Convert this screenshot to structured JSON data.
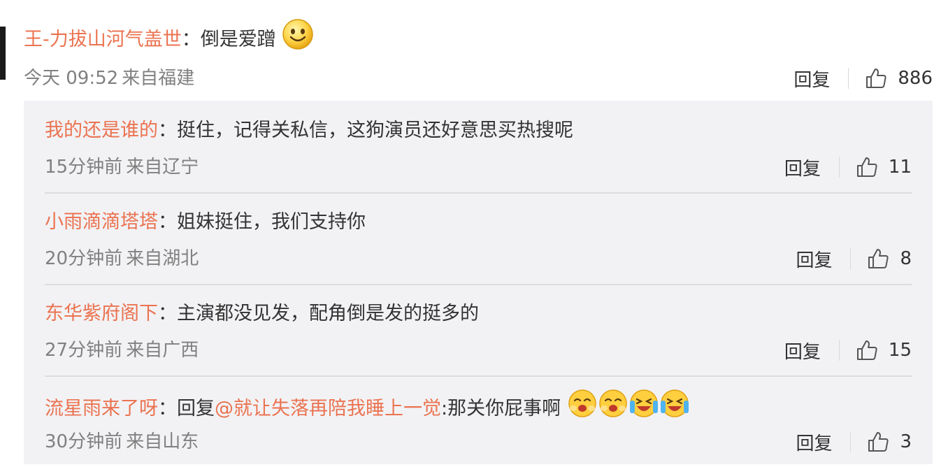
{
  "top_comment": {
    "username": "王-力拔山河气盖世",
    "separator": "：",
    "text": "倒是爱蹭",
    "time": "今天 09:52",
    "source": "来自福建",
    "reply_label": "回复",
    "likes": "886"
  },
  "replies": [
    {
      "username": "我的还是谁的",
      "separator": "：",
      "text": "挺住，记得关私信，这狗演员还好意思买热搜呢",
      "time": "15分钟前",
      "source": "来自辽宁",
      "reply_label": "回复",
      "likes": "11"
    },
    {
      "username": "小雨滴滴塔塔",
      "separator": "：",
      "text": "姐妹挺住，我们支持你",
      "time": "20分钟前",
      "source": "来自湖北",
      "reply_label": "回复",
      "likes": "8"
    },
    {
      "username": "东华紫府阁下",
      "separator": "：",
      "text": "主演都没见发，配角倒是发的挺多的",
      "time": "27分钟前",
      "source": "来自广西",
      "reply_label": "回复",
      "likes": "15"
    },
    {
      "username": "流星雨来了呀",
      "separator": "：",
      "reply_prefix": "回复",
      "mention": "@就让失落再陪我睡上一觉",
      "text": ":那关你屁事啊",
      "time": "30分钟前",
      "source": "来自山东",
      "reply_label": "回复",
      "likes": "3"
    }
  ],
  "icons": {
    "smile": "smile-emoji-icon",
    "like": "thumbs-up-icon",
    "shocked": "shocked-emoji-icon",
    "crying_laugh": "laugh-cry-emoji-icon"
  },
  "colors": {
    "username": "#eb7350",
    "meta": "#808080",
    "reply_bg": "#f2f2f5"
  }
}
